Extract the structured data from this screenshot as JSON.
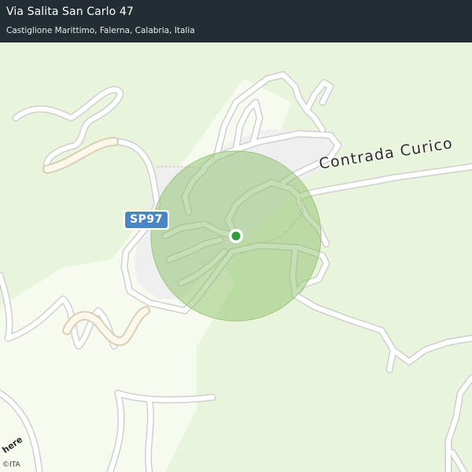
{
  "header": {
    "title": "Via Salita San Carlo 47",
    "subtitle": "Castiglione Marittimo, Falerna, Calabria, Italia"
  },
  "map": {
    "road_shield": "SP97",
    "road_label": "Contrada Curico",
    "provider_logo": "here",
    "copyright": "©ITA",
    "colors": {
      "land": "#e9f4dc",
      "built_up": "#f2f2f2",
      "road_fill": "#ffffff",
      "road_casing": "#cfcfcf",
      "accuracy_circle": "#8fbf6a",
      "location_dot": "#2e9e3a",
      "shield": "#4a86c4",
      "header": "#232d34"
    }
  }
}
